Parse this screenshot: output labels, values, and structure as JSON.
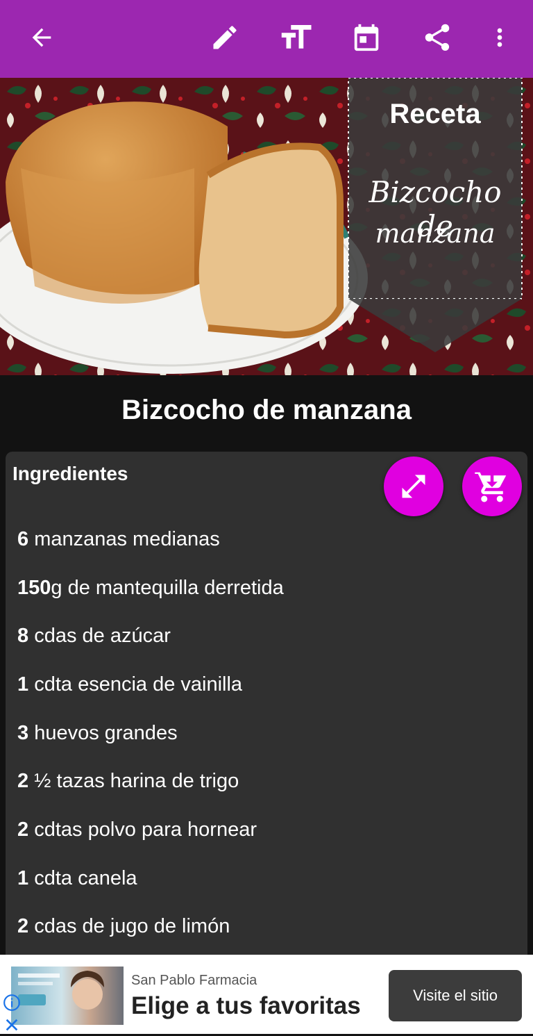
{
  "appbar": {
    "color": "#9c27b0",
    "icons": [
      "arrow-back-icon",
      "edit-icon",
      "text-size-icon",
      "calendar-icon",
      "share-icon",
      "more-vert-icon"
    ]
  },
  "hero": {
    "badge_title": "Receta",
    "badge_script_line1": "Bizcocho de",
    "badge_script_line2": "manzana"
  },
  "recipe": {
    "title": "Bizcocho de manzana"
  },
  "ingredients": {
    "heading": "Ingredientes",
    "fab_color": "#e000e0",
    "items": [
      {
        "qty": "6",
        "text": " manzanas medianas"
      },
      {
        "qty": "150",
        "text": "g de mantequilla derretida"
      },
      {
        "qty": "8",
        "text": " cdas de azúcar"
      },
      {
        "qty": "1",
        "text": " cdta esencia de vainilla"
      },
      {
        "qty": "3",
        "text": " huevos grandes"
      },
      {
        "qty": "2",
        "text": " ½ tazas harina de trigo"
      },
      {
        "qty": "2",
        "text": " cdtas polvo para hornear"
      },
      {
        "qty": "1",
        "text": " cdta canela"
      },
      {
        "qty": "2",
        "text": " cdas de jugo de limón"
      }
    ]
  },
  "ad": {
    "advertiser": "San Pablo Farmacia",
    "headline": "Elige a tus favoritas",
    "cta": "Visite el sitio"
  }
}
